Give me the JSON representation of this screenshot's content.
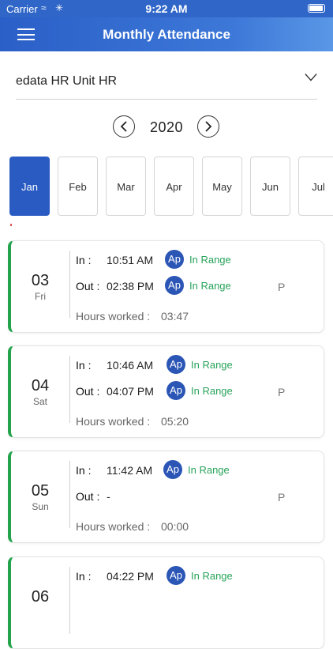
{
  "status_bar": {
    "carrier": "Carrier",
    "time": "9:22 AM"
  },
  "header": {
    "title": "Monthly Attendance",
    "menu_icon": "hamburger-icon"
  },
  "unit": {
    "selected": "edata HR Unit HR",
    "dropdown_icon": "chevron-down-icon"
  },
  "year": {
    "value": "2020",
    "prev_icon": "chevron-left-icon",
    "next_icon": "chevron-right-icon"
  },
  "months": [
    "Jan",
    "Feb",
    "Mar",
    "Apr",
    "May",
    "Jun",
    "Jul"
  ],
  "active_month": "Jan",
  "labels": {
    "in": "In :",
    "out": "Out :",
    "ap_badge": "Ap",
    "hours_prefix": "Hours worked :"
  },
  "records": [
    {
      "day": "03",
      "weekday": "Fri",
      "in_time": "10:51 AM",
      "in_range": "In Range",
      "out_time": "02:38 PM",
      "out_range": "In Range",
      "status": "P",
      "hours": "03:47"
    },
    {
      "day": "04",
      "weekday": "Sat",
      "in_time": "10:46 AM",
      "in_range": "In Range",
      "out_time": "04:07 PM",
      "out_range": "In Range",
      "status": "P",
      "hours": "05:20"
    },
    {
      "day": "05",
      "weekday": "Sun",
      "in_time": "11:42 AM",
      "in_range": "In Range",
      "out_time": "-",
      "out_range": "",
      "status": "P",
      "hours": "00:00"
    },
    {
      "day": "06",
      "weekday": "",
      "in_time": "04:22 PM",
      "in_range": "In Range",
      "out_time": "",
      "out_range": "",
      "status": "",
      "hours": ""
    }
  ],
  "colors": {
    "primary": "#2a5bc2",
    "present_bar": "#24a34d",
    "in_range_text": "#27a35a",
    "ap_badge": "#2b56b6"
  }
}
